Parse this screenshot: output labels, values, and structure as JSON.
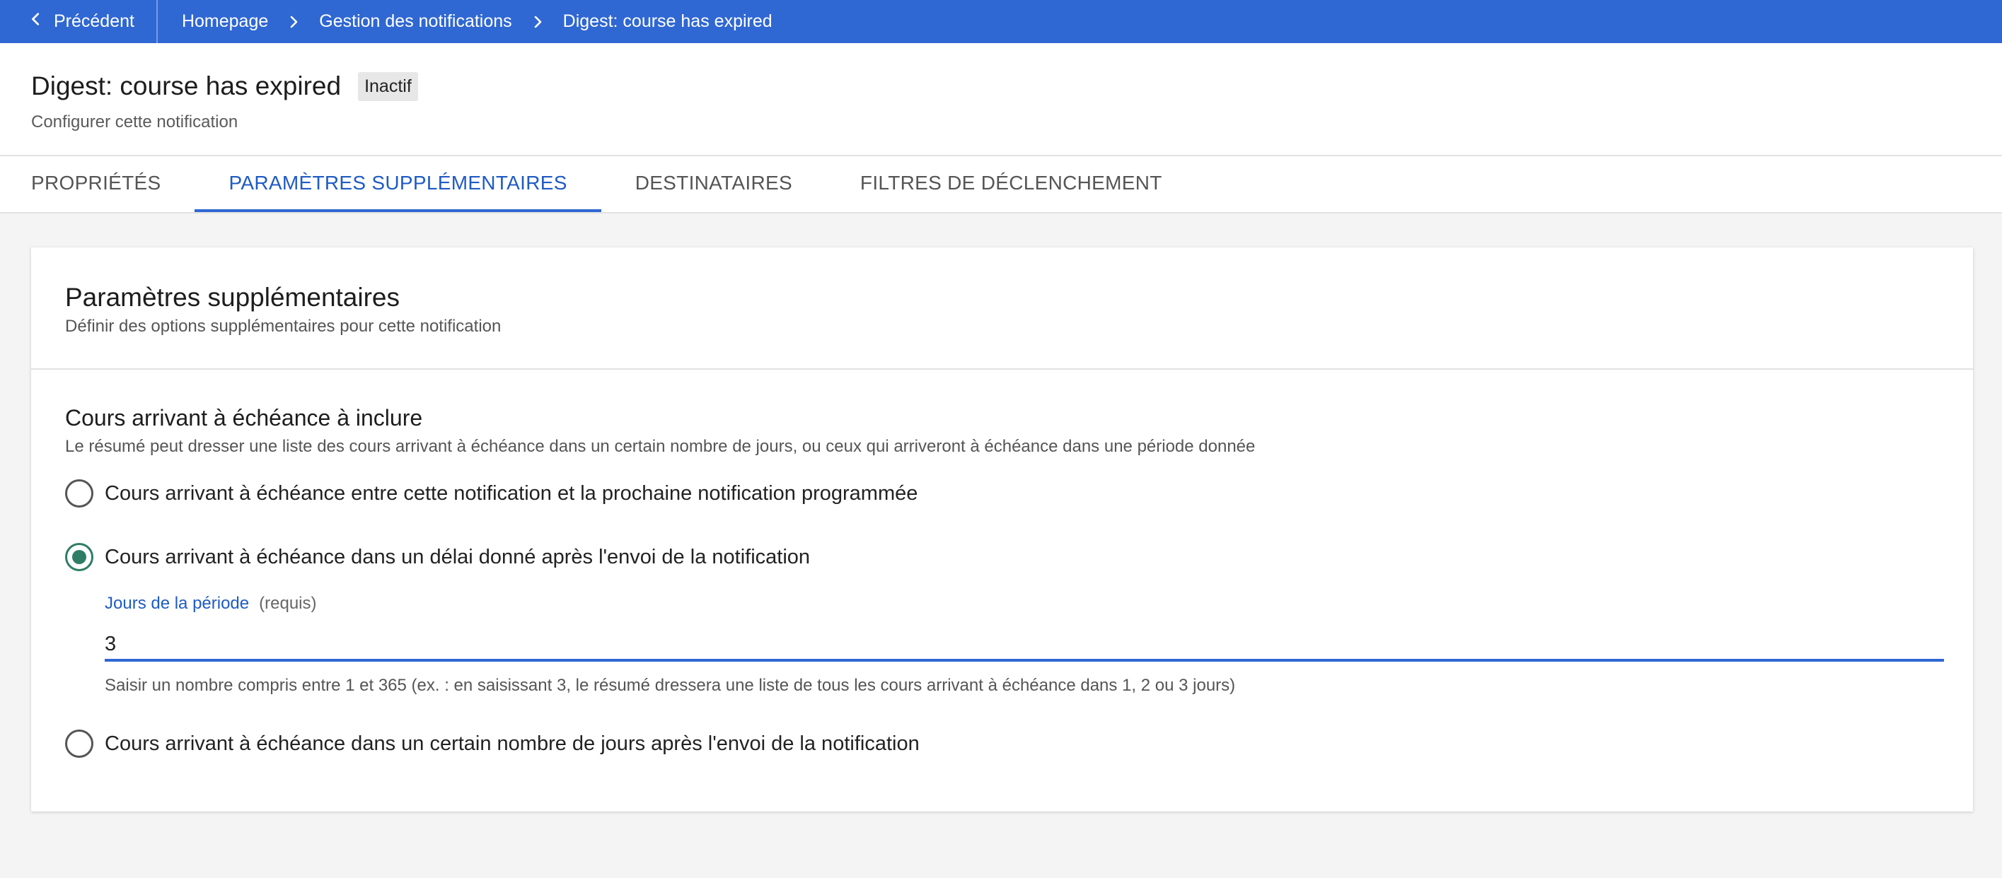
{
  "topbar": {
    "back_label": "Précédent",
    "breadcrumbs": [
      "Homepage",
      "Gestion des notifications",
      "Digest: course has expired"
    ]
  },
  "header": {
    "title": "Digest: course has expired",
    "status_badge": "Inactif",
    "subtitle": "Configurer cette notification"
  },
  "tabs": [
    {
      "label": "PROPRIÉTÉS",
      "active": false
    },
    {
      "label": "PARAMÈTRES SUPPLÉMENTAIRES",
      "active": true
    },
    {
      "label": "DESTINATAIRES",
      "active": false
    },
    {
      "label": "FILTRES DE DÉCLENCHEMENT",
      "active": false
    }
  ],
  "card": {
    "title": "Paramètres supplémentaires",
    "description": "Définir des options supplémentaires pour cette notification",
    "section": {
      "title": "Cours arrivant à échéance à inclure",
      "description": "Le résumé peut dresser une liste des cours arrivant à échéance dans un certain nombre de jours, ou ceux qui arriveront à échéance dans une période donnée",
      "options": [
        {
          "label": "Cours arrivant à échéance entre cette notification et la prochaine notification programmée",
          "checked": false
        },
        {
          "label": "Cours arrivant à échéance dans un délai donné après l'envoi de la notification",
          "checked": true
        },
        {
          "label": "Cours arrivant à échéance dans un certain nombre de jours après l'envoi de la notification",
          "checked": false
        }
      ],
      "period_field": {
        "label": "Jours de la période",
        "required_text": "(requis)",
        "value": "3",
        "hint": "Saisir un nombre compris entre 1 et 365 (ex. : en saisissant 3, le résumé dressera une liste de tous les cours arrivant à échéance dans 1, 2 ou 3 jours)"
      }
    }
  },
  "colors": {
    "topbar": "#2f67d3",
    "accent": "#1f5bc4",
    "radio_checked": "#2e7d64"
  }
}
